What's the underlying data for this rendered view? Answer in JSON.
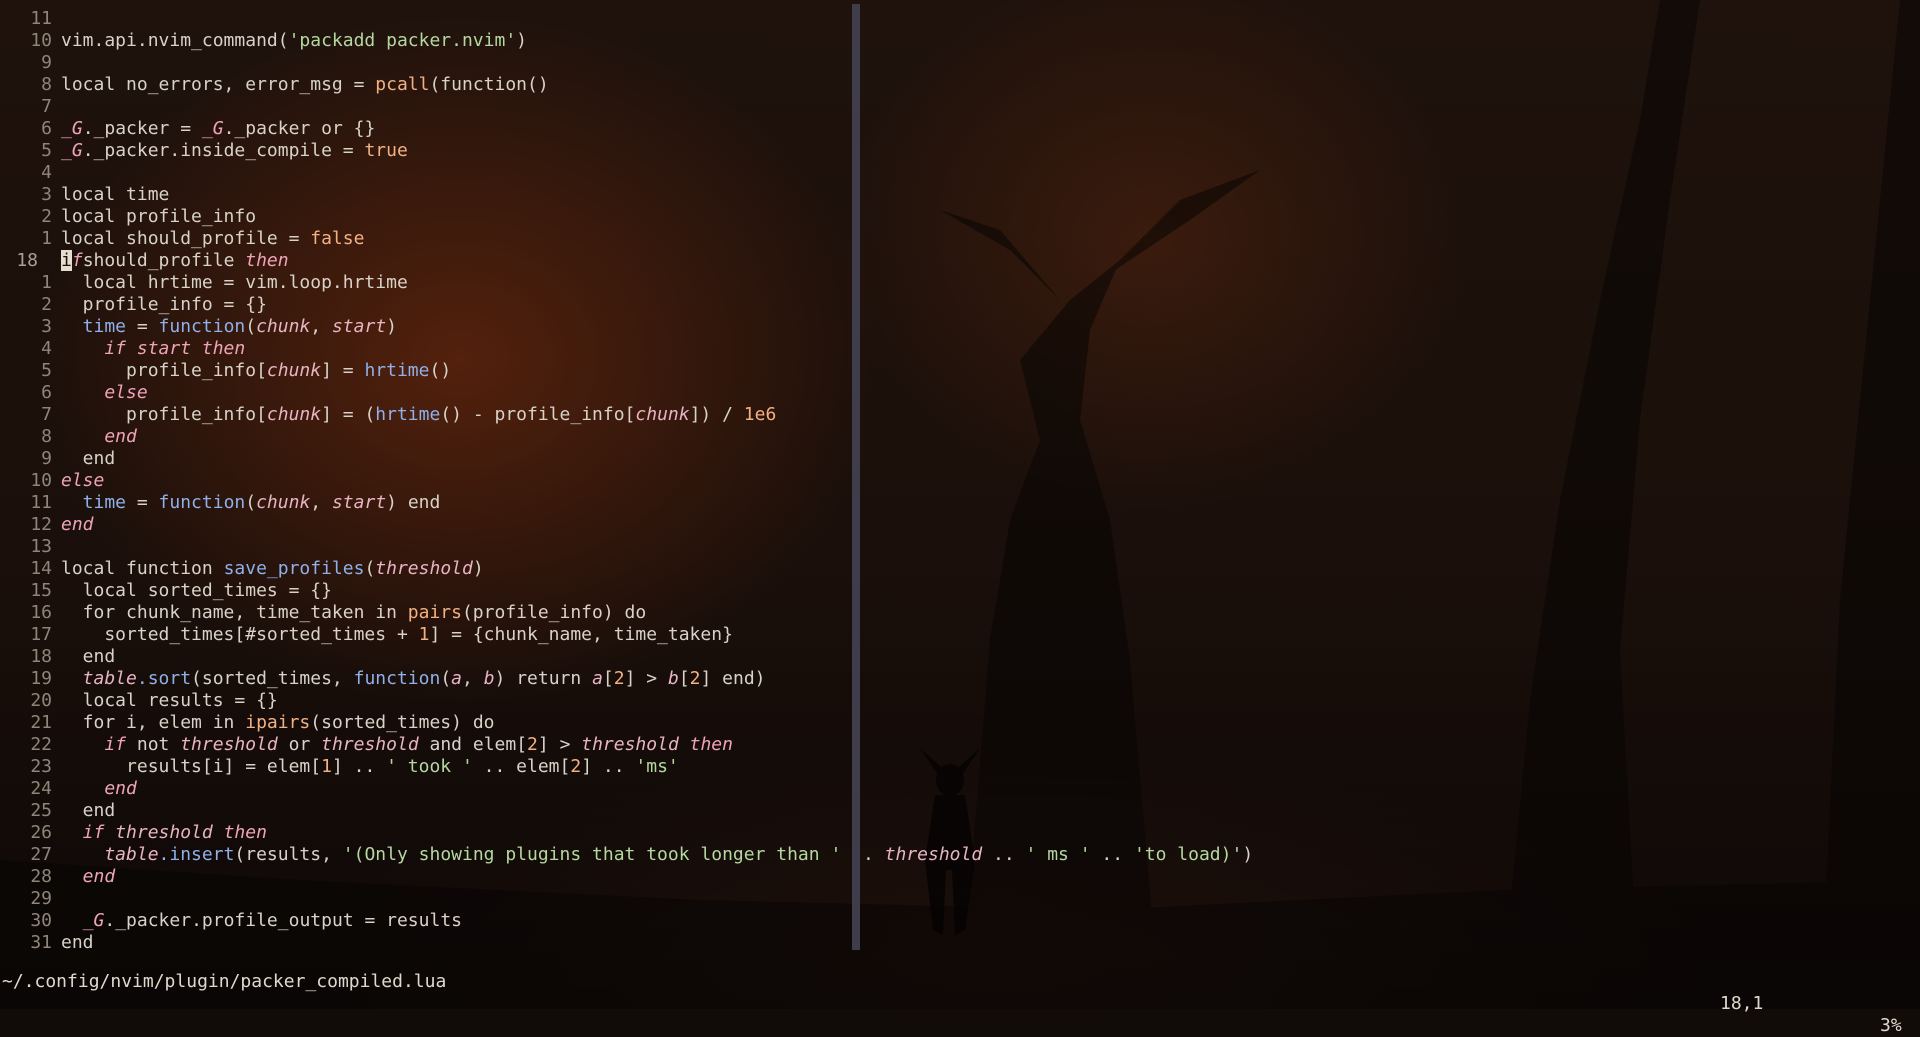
{
  "editor": {
    "lines": [
      {
        "num": "11",
        "segs": []
      },
      {
        "num": "10",
        "segs": [
          [
            "",
            "vim.api.nvim_command("
          ],
          [
            "str",
            "'packadd packer.nvim'"
          ],
          [
            "",
            ")"
          ]
        ]
      },
      {
        "num": "9",
        "segs": []
      },
      {
        "num": "8",
        "segs": [
          [
            "",
            "local no_errors, error_msg = "
          ],
          [
            "num",
            "pcall"
          ],
          [
            "",
            "(function()"
          ]
        ]
      },
      {
        "num": "7",
        "segs": []
      },
      {
        "num": "6",
        "segs": [
          [
            "glob",
            "_G"
          ],
          [
            "",
            "._packer = "
          ],
          [
            "glob",
            "_G"
          ],
          [
            "",
            "._packer or {}"
          ]
        ]
      },
      {
        "num": "5",
        "segs": [
          [
            "glob",
            "_G"
          ],
          [
            "",
            "._packer.inside_compile = "
          ],
          [
            "num",
            "true"
          ]
        ]
      },
      {
        "num": "4",
        "segs": []
      },
      {
        "num": "3",
        "segs": [
          [
            "",
            "local time"
          ]
        ]
      },
      {
        "num": "2",
        "segs": [
          [
            "",
            "local profile_info"
          ]
        ]
      },
      {
        "num": "1",
        "segs": [
          [
            "",
            "local should_profile = "
          ],
          [
            "num",
            "false"
          ]
        ]
      },
      {
        "num": "18",
        "cur": true,
        "segs": [
          [
            "cursor",
            "i"
          ],
          [
            "kwi",
            "f"
          ],
          [
            "",
            "",
            " "
          ],
          [
            "",
            "should_profile "
          ],
          [
            "kwi",
            "then"
          ]
        ]
      },
      {
        "num": "1",
        "segs": [
          [
            "",
            "  local hrtime = vim.loop.hrtime"
          ]
        ]
      },
      {
        "num": "2",
        "segs": [
          [
            "",
            "  profile_info = {}"
          ]
        ]
      },
      {
        "num": "3",
        "segs": [
          [
            "fn",
            "  time"
          ],
          [
            "",
            " = "
          ],
          [
            "fn",
            "function"
          ],
          [
            "",
            "("
          ],
          [
            "par",
            "chunk"
          ],
          [
            "",
            ", "
          ],
          [
            "par",
            "start"
          ],
          [
            "",
            ")"
          ]
        ]
      },
      {
        "num": "4",
        "segs": [
          [
            "kwi",
            "    if start then"
          ]
        ]
      },
      {
        "num": "5",
        "segs": [
          [
            "",
            "      profile_info["
          ],
          [
            "par",
            "chunk"
          ],
          [
            "",
            "] = "
          ],
          [
            "fn",
            "hrtime"
          ],
          [
            "",
            "()"
          ]
        ]
      },
      {
        "num": "6",
        "segs": [
          [
            "kwi",
            "    else"
          ]
        ]
      },
      {
        "num": "7",
        "segs": [
          [
            "",
            "      profile_info["
          ],
          [
            "par",
            "chunk"
          ],
          [
            "",
            "] = ("
          ],
          [
            "fn",
            "hrtime"
          ],
          [
            "",
            "() - profile_info["
          ],
          [
            "par",
            "chunk"
          ],
          [
            "",
            "]) / "
          ],
          [
            "num",
            "1e6"
          ]
        ]
      },
      {
        "num": "8",
        "segs": [
          [
            "kwi",
            "    end"
          ]
        ]
      },
      {
        "num": "9",
        "segs": [
          [
            "",
            "  end"
          ]
        ]
      },
      {
        "num": "10",
        "segs": [
          [
            "kwi",
            "else"
          ]
        ]
      },
      {
        "num": "11",
        "segs": [
          [
            "fn",
            "  time"
          ],
          [
            "",
            " = "
          ],
          [
            "fn",
            "function"
          ],
          [
            "",
            "("
          ],
          [
            "par",
            "chunk"
          ],
          [
            "",
            ", "
          ],
          [
            "par",
            "start"
          ],
          [
            "",
            ") end"
          ]
        ]
      },
      {
        "num": "12",
        "segs": [
          [
            "kwi",
            "end"
          ]
        ]
      },
      {
        "num": "13",
        "segs": []
      },
      {
        "num": "14",
        "segs": [
          [
            "",
            "local function "
          ],
          [
            "fn",
            "save_profiles"
          ],
          [
            "",
            "("
          ],
          [
            "par",
            "threshold"
          ],
          [
            "",
            ")"
          ]
        ]
      },
      {
        "num": "15",
        "segs": [
          [
            "",
            "  local sorted_times = {}"
          ]
        ]
      },
      {
        "num": "16",
        "segs": [
          [
            "",
            "  for chunk_name, time_taken in "
          ],
          [
            "num",
            "pairs"
          ],
          [
            "",
            "(profile_info) do"
          ]
        ]
      },
      {
        "num": "17",
        "segs": [
          [
            "",
            "    sorted_times[#sorted_times + "
          ],
          [
            "num",
            "1"
          ],
          [
            "",
            "] = {chunk_name, time_taken}"
          ]
        ]
      },
      {
        "num": "18",
        "segs": [
          [
            "",
            "  end"
          ]
        ]
      },
      {
        "num": "19",
        "segs": [
          [
            "par",
            "  table"
          ],
          [
            ".",
            ""
          ],
          [
            "fn",
            ".sort"
          ],
          [
            "",
            "(sorted_times, "
          ],
          [
            "fn",
            "function"
          ],
          [
            "",
            "("
          ],
          [
            "par",
            "a"
          ],
          [
            "",
            ", "
          ],
          [
            "par",
            "b"
          ],
          [
            "",
            ") return "
          ],
          [
            "par",
            "a"
          ],
          [
            "",
            "["
          ],
          [
            "num",
            "2"
          ],
          [
            "",
            "] > "
          ],
          [
            "par",
            "b"
          ],
          [
            "",
            "["
          ],
          [
            "num",
            "2"
          ],
          [
            "",
            "] end)"
          ]
        ]
      },
      {
        "num": "20",
        "segs": [
          [
            "",
            "  local results = {}"
          ]
        ]
      },
      {
        "num": "21",
        "segs": [
          [
            "",
            "  for i, elem in "
          ],
          [
            "num",
            "ipairs"
          ],
          [
            "",
            "(sorted_times) do"
          ]
        ]
      },
      {
        "num": "22",
        "segs": [
          [
            "kwi",
            "    if"
          ],
          [
            "",
            " not "
          ],
          [
            "par",
            "threshold"
          ],
          [
            "",
            " or "
          ],
          [
            "par",
            "threshold"
          ],
          [
            "",
            " and elem["
          ],
          [
            "num",
            "2"
          ],
          [
            "",
            "] > "
          ],
          [
            "par",
            "threshold"
          ],
          [
            "kwi",
            " then"
          ]
        ]
      },
      {
        "num": "23",
        "segs": [
          [
            "",
            "      results[i] = elem["
          ],
          [
            "num",
            "1"
          ],
          [
            "",
            "] .. "
          ],
          [
            "str",
            "' took '"
          ],
          [
            "",
            " .. elem["
          ],
          [
            "num",
            "2"
          ],
          [
            "",
            "] .. "
          ],
          [
            "str",
            "'ms'"
          ]
        ]
      },
      {
        "num": "24",
        "segs": [
          [
            "kwi",
            "    end"
          ]
        ]
      },
      {
        "num": "25",
        "segs": [
          [
            "",
            "  end"
          ]
        ]
      },
      {
        "num": "26",
        "segs": [
          [
            "kwi",
            "  if "
          ],
          [
            "par",
            "threshold"
          ],
          [
            "kwi",
            " then"
          ]
        ]
      },
      {
        "num": "27",
        "segs": [
          [
            "par",
            "    table"
          ],
          [
            "fn",
            ".insert"
          ],
          [
            "",
            "(results, "
          ],
          [
            "str",
            "'(Only showing plugins that took longer than '"
          ],
          [
            "",
            " .. "
          ],
          [
            "par",
            "threshold"
          ],
          [
            "",
            " .. "
          ],
          [
            "str",
            "' ms '"
          ],
          [
            "",
            " .. "
          ],
          [
            "str",
            "'to load)'"
          ],
          [
            "",
            ")"
          ]
        ]
      },
      {
        "num": "28",
        "segs": [
          [
            "kwi",
            "  end"
          ]
        ]
      },
      {
        "num": "29",
        "segs": []
      },
      {
        "num": "30",
        "segs": [
          [
            "",
            "  "
          ],
          [
            "glob",
            "_G"
          ],
          [
            "",
            "._packer.profile_output = results"
          ]
        ]
      },
      {
        "num": "31",
        "segs": [
          [
            "",
            "end"
          ]
        ]
      }
    ]
  },
  "statusline": {
    "file": "~/.config/nvim/plugin/packer_compiled.lua",
    "position": "18,1",
    "percent": "3%"
  }
}
